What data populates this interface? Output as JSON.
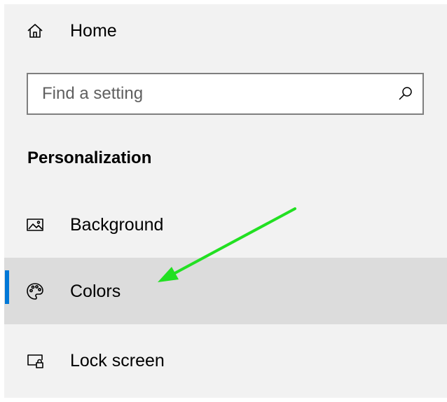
{
  "nav": {
    "home": {
      "label": "Home",
      "icon": "home-icon"
    },
    "search": {
      "placeholder": "Find a setting",
      "value": "",
      "icon": "search-icon"
    },
    "section_title": "Personalization",
    "items": [
      {
        "label": "Background",
        "icon": "picture-icon",
        "selected": false
      },
      {
        "label": "Colors",
        "icon": "palette-icon",
        "selected": true
      },
      {
        "label": "Lock screen",
        "icon": "lock-screen-icon",
        "selected": false
      }
    ]
  },
  "colors": {
    "panel_background": "#f2f2f2",
    "selected_background": "#dcdcdc",
    "accent": "#0078d7",
    "annotation_arrow": "#22e022"
  }
}
